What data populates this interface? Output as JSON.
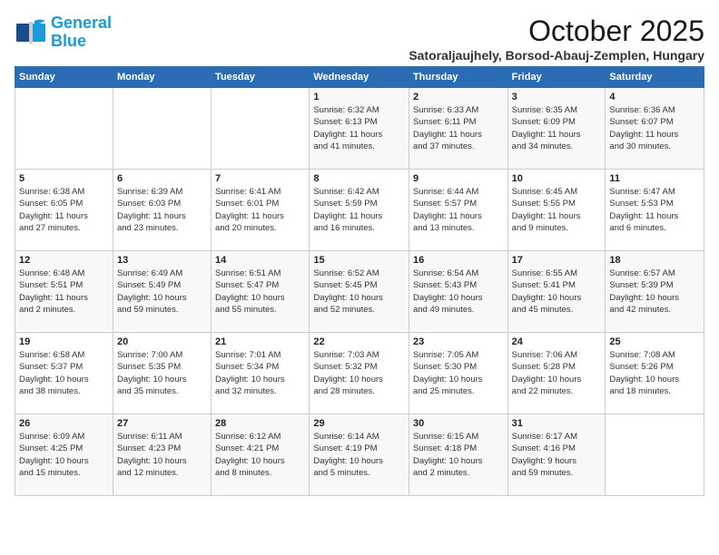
{
  "header": {
    "logo_line1": "General",
    "logo_line2": "Blue",
    "month": "October 2025",
    "location": "Satoraljaujhely, Borsod-Abauj-Zemplen, Hungary"
  },
  "days_of_week": [
    "Sunday",
    "Monday",
    "Tuesday",
    "Wednesday",
    "Thursday",
    "Friday",
    "Saturday"
  ],
  "weeks": [
    [
      {
        "day": "",
        "info": ""
      },
      {
        "day": "",
        "info": ""
      },
      {
        "day": "",
        "info": ""
      },
      {
        "day": "1",
        "info": "Sunrise: 6:32 AM\nSunset: 6:13 PM\nDaylight: 11 hours\nand 41 minutes."
      },
      {
        "day": "2",
        "info": "Sunrise: 6:33 AM\nSunset: 6:11 PM\nDaylight: 11 hours\nand 37 minutes."
      },
      {
        "day": "3",
        "info": "Sunrise: 6:35 AM\nSunset: 6:09 PM\nDaylight: 11 hours\nand 34 minutes."
      },
      {
        "day": "4",
        "info": "Sunrise: 6:36 AM\nSunset: 6:07 PM\nDaylight: 11 hours\nand 30 minutes."
      }
    ],
    [
      {
        "day": "5",
        "info": "Sunrise: 6:38 AM\nSunset: 6:05 PM\nDaylight: 11 hours\nand 27 minutes."
      },
      {
        "day": "6",
        "info": "Sunrise: 6:39 AM\nSunset: 6:03 PM\nDaylight: 11 hours\nand 23 minutes."
      },
      {
        "day": "7",
        "info": "Sunrise: 6:41 AM\nSunset: 6:01 PM\nDaylight: 11 hours\nand 20 minutes."
      },
      {
        "day": "8",
        "info": "Sunrise: 6:42 AM\nSunset: 5:59 PM\nDaylight: 11 hours\nand 16 minutes."
      },
      {
        "day": "9",
        "info": "Sunrise: 6:44 AM\nSunset: 5:57 PM\nDaylight: 11 hours\nand 13 minutes."
      },
      {
        "day": "10",
        "info": "Sunrise: 6:45 AM\nSunset: 5:55 PM\nDaylight: 11 hours\nand 9 minutes."
      },
      {
        "day": "11",
        "info": "Sunrise: 6:47 AM\nSunset: 5:53 PM\nDaylight: 11 hours\nand 6 minutes."
      }
    ],
    [
      {
        "day": "12",
        "info": "Sunrise: 6:48 AM\nSunset: 5:51 PM\nDaylight: 11 hours\nand 2 minutes."
      },
      {
        "day": "13",
        "info": "Sunrise: 6:49 AM\nSunset: 5:49 PM\nDaylight: 10 hours\nand 59 minutes."
      },
      {
        "day": "14",
        "info": "Sunrise: 6:51 AM\nSunset: 5:47 PM\nDaylight: 10 hours\nand 55 minutes."
      },
      {
        "day": "15",
        "info": "Sunrise: 6:52 AM\nSunset: 5:45 PM\nDaylight: 10 hours\nand 52 minutes."
      },
      {
        "day": "16",
        "info": "Sunrise: 6:54 AM\nSunset: 5:43 PM\nDaylight: 10 hours\nand 49 minutes."
      },
      {
        "day": "17",
        "info": "Sunrise: 6:55 AM\nSunset: 5:41 PM\nDaylight: 10 hours\nand 45 minutes."
      },
      {
        "day": "18",
        "info": "Sunrise: 6:57 AM\nSunset: 5:39 PM\nDaylight: 10 hours\nand 42 minutes."
      }
    ],
    [
      {
        "day": "19",
        "info": "Sunrise: 6:58 AM\nSunset: 5:37 PM\nDaylight: 10 hours\nand 38 minutes."
      },
      {
        "day": "20",
        "info": "Sunrise: 7:00 AM\nSunset: 5:35 PM\nDaylight: 10 hours\nand 35 minutes."
      },
      {
        "day": "21",
        "info": "Sunrise: 7:01 AM\nSunset: 5:34 PM\nDaylight: 10 hours\nand 32 minutes."
      },
      {
        "day": "22",
        "info": "Sunrise: 7:03 AM\nSunset: 5:32 PM\nDaylight: 10 hours\nand 28 minutes."
      },
      {
        "day": "23",
        "info": "Sunrise: 7:05 AM\nSunset: 5:30 PM\nDaylight: 10 hours\nand 25 minutes."
      },
      {
        "day": "24",
        "info": "Sunrise: 7:06 AM\nSunset: 5:28 PM\nDaylight: 10 hours\nand 22 minutes."
      },
      {
        "day": "25",
        "info": "Sunrise: 7:08 AM\nSunset: 5:26 PM\nDaylight: 10 hours\nand 18 minutes."
      }
    ],
    [
      {
        "day": "26",
        "info": "Sunrise: 6:09 AM\nSunset: 4:25 PM\nDaylight: 10 hours\nand 15 minutes."
      },
      {
        "day": "27",
        "info": "Sunrise: 6:11 AM\nSunset: 4:23 PM\nDaylight: 10 hours\nand 12 minutes."
      },
      {
        "day": "28",
        "info": "Sunrise: 6:12 AM\nSunset: 4:21 PM\nDaylight: 10 hours\nand 8 minutes."
      },
      {
        "day": "29",
        "info": "Sunrise: 6:14 AM\nSunset: 4:19 PM\nDaylight: 10 hours\nand 5 minutes."
      },
      {
        "day": "30",
        "info": "Sunrise: 6:15 AM\nSunset: 4:18 PM\nDaylight: 10 hours\nand 2 minutes."
      },
      {
        "day": "31",
        "info": "Sunrise: 6:17 AM\nSunset: 4:16 PM\nDaylight: 9 hours\nand 59 minutes."
      },
      {
        "day": "",
        "info": ""
      }
    ]
  ]
}
